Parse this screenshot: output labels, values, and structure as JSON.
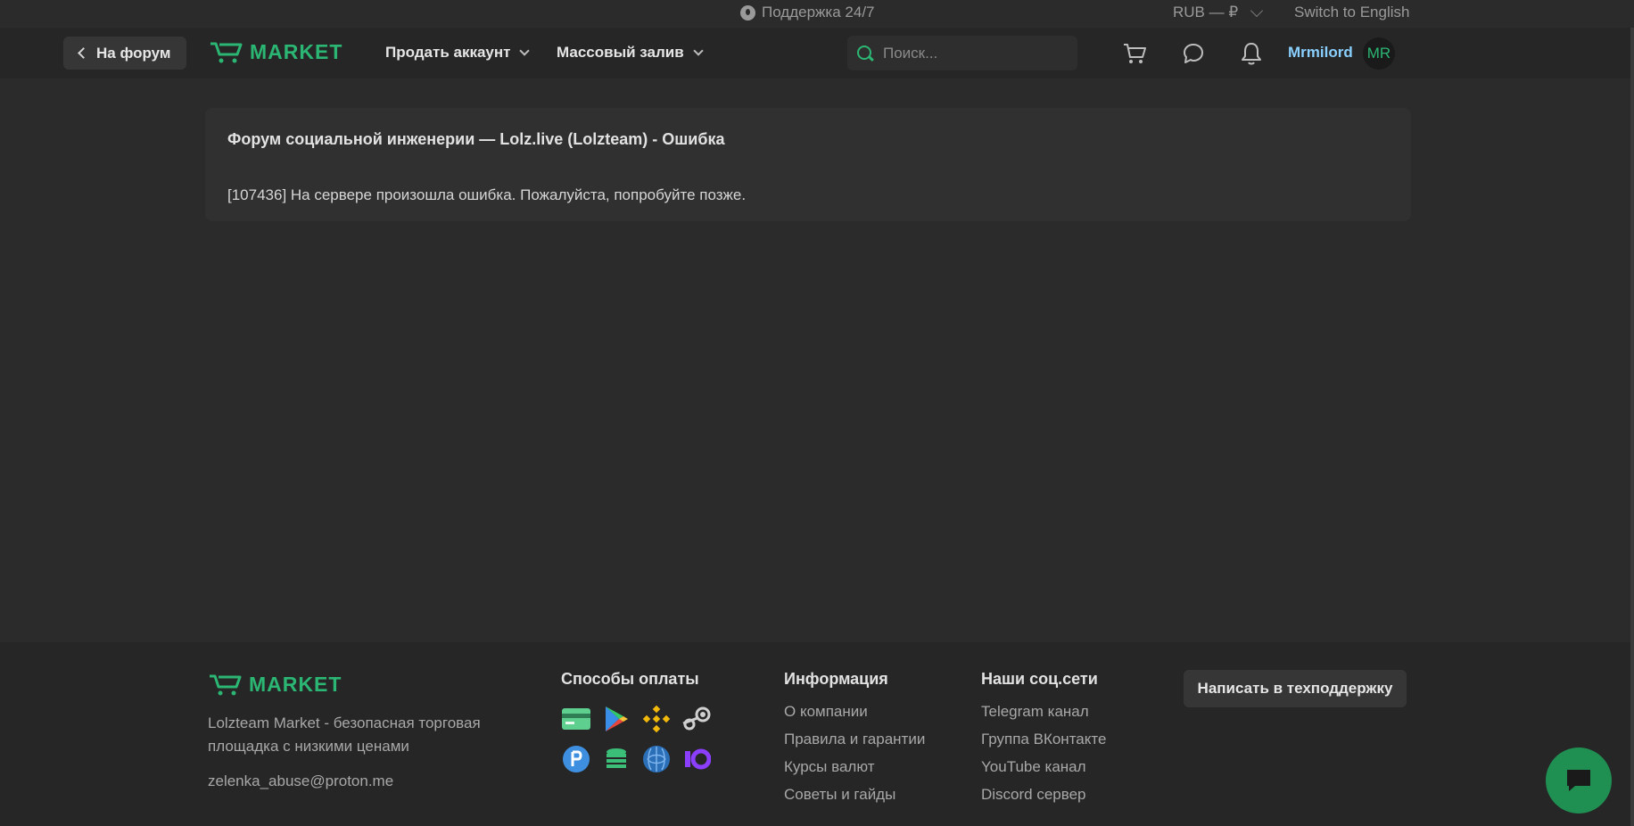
{
  "topbar": {
    "support_label": "Поддержка 24/7",
    "currency_label": "RUB — ₽",
    "switch_language": "Switch to English"
  },
  "header": {
    "back_label": "На форум",
    "logo_text": "MARKET",
    "nav": [
      {
        "label": "Продать аккаунт"
      },
      {
        "label": "Массовый залив"
      }
    ],
    "search_placeholder": "Поиск...",
    "username": "Mrmilord",
    "avatar_initials": "MR"
  },
  "error": {
    "title": "Форум социальной инженерии — Lolz.live (Lolzteam) - Ошибка",
    "message": "[107436] На сервере произошла ошибка. Пожалуйста, попробуйте позже."
  },
  "footer": {
    "logo_text": "MARKET",
    "description": "Lolzteam Market - безопасная торговая площадка с низкими ценами",
    "email": "zelenka_abuse@proton.me",
    "payment_heading": "Способы оплаты",
    "payment_icons": [
      "card-icon",
      "google-play-icon",
      "binance-icon",
      "steam-icon",
      "p-icon",
      "coins-icon",
      "webmoney-icon",
      "yoomoney-icon"
    ],
    "info_heading": "Информация",
    "info_links": [
      "О компании",
      "Правила и гарантии",
      "Курсы валют",
      "Советы и гайды"
    ],
    "social_heading": "Наши соц.сети",
    "social_links": [
      "Telegram канал",
      "Группа ВКонтакте",
      "YouTube канал",
      "Discord сервер"
    ],
    "support_button": "Написать в техподдержку"
  },
  "colors": {
    "accent": "#2bb673",
    "background": "#2b2b2b",
    "header_bg": "#262626",
    "username": "#8ad0ff"
  }
}
